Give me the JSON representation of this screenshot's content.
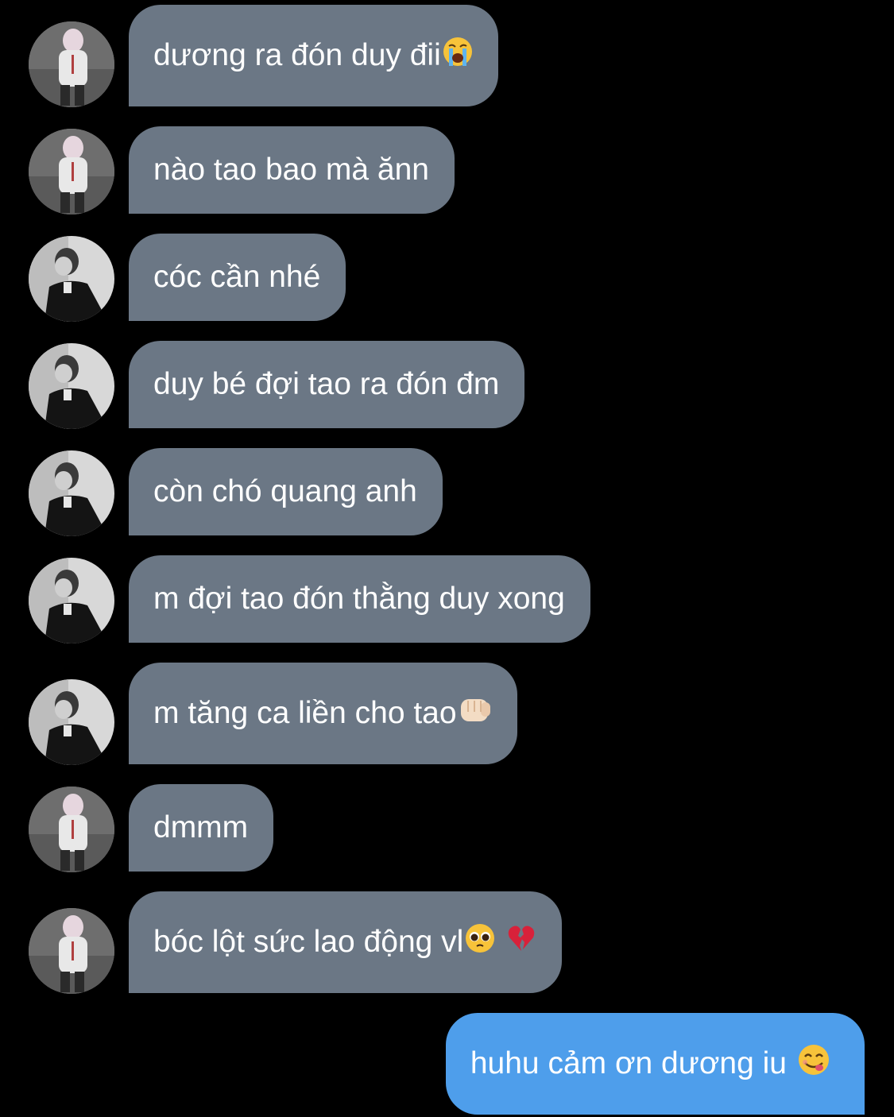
{
  "messages": [
    {
      "text": "dương ra đón duy đii",
      "emoji": "loudly-crying-face-emoji",
      "sender": "friend-a"
    },
    {
      "text": "nào tao bao mà ănn",
      "sender": "friend-a"
    },
    {
      "text": "cóc cần nhé",
      "sender": "friend-b"
    },
    {
      "text": "duy bé đợi tao ra đón đm",
      "sender": "friend-b"
    },
    {
      "text": "còn chó quang anh",
      "sender": "friend-b"
    },
    {
      "text": "m đợi tao đón thằng duy xong",
      "sender": "friend-b"
    },
    {
      "text": "m tăng ca liền cho tao",
      "emoji": "oncoming-fist-emoji",
      "sender": "friend-b"
    },
    {
      "text": "dmmm",
      "sender": "friend-a"
    },
    {
      "text": "bóc lột sức lao động vl",
      "emoji": "pleading-face-emoji broken-heart-emoji",
      "sender": "friend-a"
    }
  ],
  "sent_message": {
    "text": "huhu cảm ơn dương iu",
    "emoji": "face-savoring-food-emoji"
  },
  "colors": {
    "background": "#000000",
    "received_bubble": "#6b7785",
    "sent_bubble": "#4e9eeb",
    "text": "#ffffff"
  }
}
